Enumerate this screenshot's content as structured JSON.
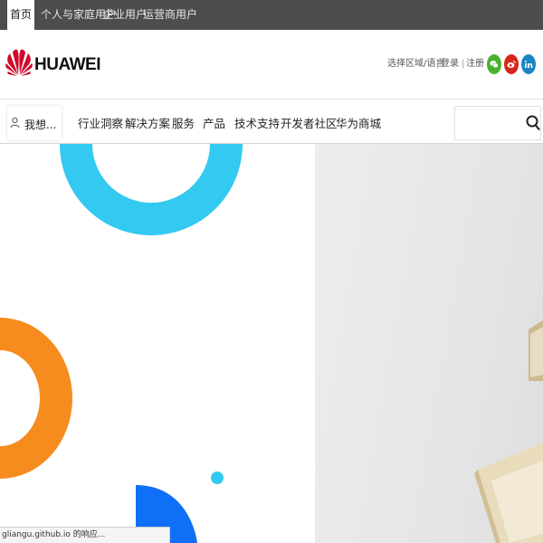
{
  "top_tabs": [
    "首页",
    "个人与家庭用户",
    "企业用户",
    "运营商用户"
  ],
  "header": {
    "brand": "HUAWEI",
    "region": "选择区域/语言",
    "separator": "|",
    "login": "登录",
    "register": "注册",
    "social_icons": [
      "wechat-icon",
      "weibo-icon",
      "linkedin-icon"
    ]
  },
  "nav": {
    "wish_label": "我想...",
    "items": [
      "行业洞察",
      "解决方案",
      "服务",
      "产品",
      "技术支持",
      "开发者社区",
      "华为商城"
    ],
    "search_placeholder": ""
  },
  "status_bar": "gliangu.github.io 的响应...",
  "colors": {
    "topbar": "#4d4d4d",
    "brand_red": "#cf0a2c",
    "shape_cyan": "#33c9f0",
    "shape_orange": "#f78c1e",
    "shape_blue": "#0f6ff6"
  }
}
